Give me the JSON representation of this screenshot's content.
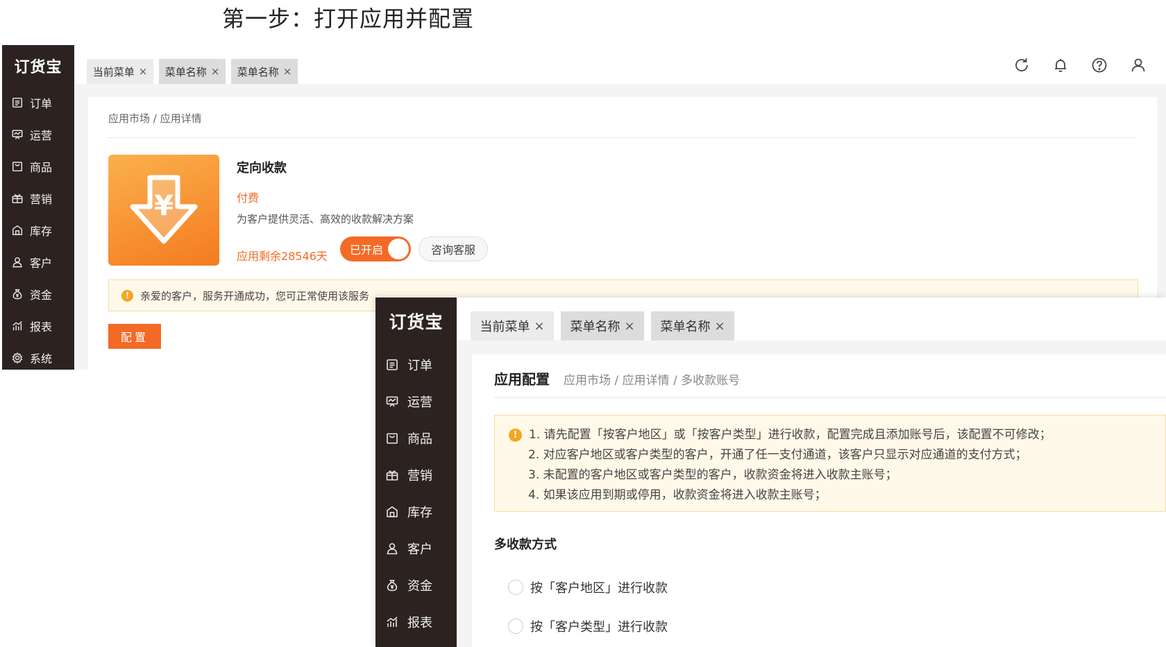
{
  "heading": "第一步：打开应用并配置",
  "logo": "订货宝",
  "sidebar": {
    "items": [
      {
        "label": "订单",
        "icon": "order-list-icon"
      },
      {
        "label": "运营",
        "icon": "operation-icon"
      },
      {
        "label": "商品",
        "icon": "product-bag-icon"
      },
      {
        "label": "营销",
        "icon": "gift-icon"
      },
      {
        "label": "库存",
        "icon": "warehouse-icon"
      },
      {
        "label": "客户",
        "icon": "customer-icon"
      },
      {
        "label": "资金",
        "icon": "money-bag-icon"
      },
      {
        "label": "报表",
        "icon": "chart-icon"
      },
      {
        "label": "系统",
        "icon": "gear-icon"
      }
    ]
  },
  "tabs": [
    {
      "label": "当前菜单",
      "close": "×"
    },
    {
      "label": "菜单名称",
      "close": "×"
    },
    {
      "label": "菜单名称",
      "close": "×"
    }
  ],
  "top_icons": [
    "refresh-icon",
    "bell-icon",
    "help-icon",
    "user-icon"
  ],
  "app_detail": {
    "breadcrumb": "应用市场 / 应用详情",
    "title": "定向收款",
    "price": "付费",
    "description": "为客户提供灵活、高效的收款解决方案",
    "remaining": "应用剩余28546天",
    "toggle_label": "已开启",
    "consult_label": "咨询客服",
    "notice": "亲爱的客户，服务开通成功，您可正常使用该服务",
    "config_label": "配置",
    "icon_symbol": "¥"
  },
  "app_config": {
    "title": "应用配置",
    "breadcrumb": "应用市场 / 应用详情 / 多收款账号",
    "notices": [
      "1. 请先配置「按客户地区」或「按客户类型」进行收款，配置完成且添加账号后，该配置不可修改；",
      "2. 对应客户地区或客户类型的客户，开通了任一支付通道，该客户只显示对应通道的支付方式；",
      "3. 未配置的客户地区或客户类型的客户，收款资金将进入收款主账号；",
      "4. 如果该应用到期或停用，收款资金将进入收款主账号；"
    ],
    "section": "多收款方式",
    "options": [
      "按「客户地区」进行收款",
      "按「客户类型」进行收款"
    ]
  },
  "colors": {
    "accent": "#f36a26",
    "sidebar": "#2c2321",
    "notice_bg": "#fff9e9"
  }
}
